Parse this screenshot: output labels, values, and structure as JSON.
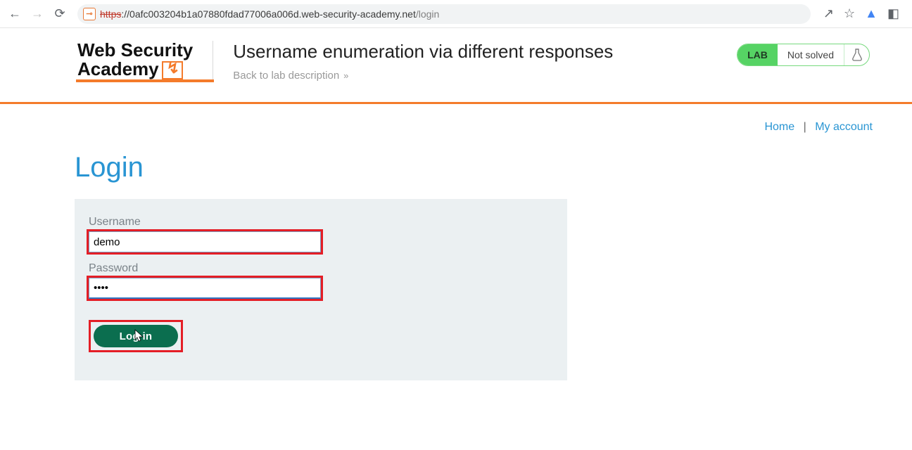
{
  "browser": {
    "url_scheme": "https",
    "url_host": "://0afc003204b1a07880fdad77006a006d.web-security-academy.net",
    "url_path": "/login"
  },
  "header": {
    "logo_line1": "Web Security",
    "logo_line2": "Academy",
    "lab_title": "Username enumeration via different responses",
    "back_link": "Back to lab description"
  },
  "status": {
    "badge": "LAB",
    "text": "Not solved"
  },
  "nav": {
    "home": "Home",
    "my_account": "My account"
  },
  "login": {
    "title": "Login",
    "username_label": "Username",
    "username_value": "demo",
    "password_label": "Password",
    "password_value": "••••",
    "button": "Log in"
  }
}
